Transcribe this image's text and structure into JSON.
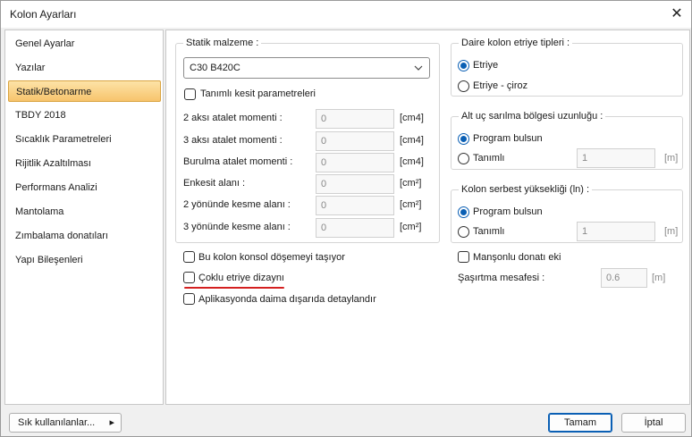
{
  "window": {
    "title": "Kolon Ayarları",
    "close_glyph": "✕"
  },
  "sidebar": {
    "items": [
      {
        "label": "Genel Ayarlar"
      },
      {
        "label": "Yazılar"
      },
      {
        "label": "Statik/Betonarme",
        "active": true
      },
      {
        "label": "TBDY 2018"
      },
      {
        "label": "Sıcaklık Parametreleri"
      },
      {
        "label": "Rijitlik Azaltılması"
      },
      {
        "label": "Performans Analizi"
      },
      {
        "label": "Mantolama"
      },
      {
        "label": "Zımbalama donatıları"
      },
      {
        "label": "Yapı Bileşenleri"
      }
    ]
  },
  "statik": {
    "group_title": "Statik malzeme :",
    "material_value": "C30 B420C",
    "custom_section_label": "Tanımlı kesit parametreleri",
    "custom_section_checked": false,
    "rows": [
      {
        "label": "2 aksı atalet momenti :",
        "value": "0",
        "unit": "[cm4]"
      },
      {
        "label": "3 aksı atalet momenti :",
        "value": "0",
        "unit": "[cm4]"
      },
      {
        "label": "Burulma atalet momenti :",
        "value": "0",
        "unit": "[cm4]"
      },
      {
        "label": "Enkesit alanı :",
        "value": "0",
        "unit": "[cm²]"
      },
      {
        "label": "2 yönünde kesme alanı :",
        "value": "0",
        "unit": "[cm²]"
      },
      {
        "label": "3 yönünde kesme alanı :",
        "value": "0",
        "unit": "[cm²]"
      }
    ]
  },
  "daire": {
    "group_title": "Daire kolon etriye tipleri :",
    "option1": "Etriye",
    "option2": "Etriye - çiroz",
    "selected": "Etriye"
  },
  "alt_uc": {
    "group_title": "Alt uç sarılma bölgesi uzunluğu :",
    "option1": "Program bulsun",
    "option2": "Tanımlı",
    "value": "1",
    "unit": "[m]"
  },
  "serbest": {
    "group_title": "Kolon serbest yüksekliği (ln) :",
    "option1": "Program bulsun",
    "option2": "Tanımlı",
    "value": "1",
    "unit": "[m]"
  },
  "options": {
    "konsol": "Bu kolon konsol döşemeyi taşıyor",
    "coklu": "Çoklu etriye dizaynı",
    "aplikasyon": "Aplikasyonda daima dışarıda detaylandır",
    "mansonlu": "Manşonlu donatı eki",
    "sasirtma_label": "Şaşırtma mesafesi :",
    "sasirtma_value": "0.6",
    "sasirtma_unit": "[m]"
  },
  "footer": {
    "favorites": "Sık kullanılanlar...",
    "favorites_arrow": "▸",
    "ok": "Tamam",
    "cancel": "İptal"
  },
  "colors": {
    "accent": "#0a5fb4",
    "selection": "#f7c46c",
    "highlight_underline": "#d42020"
  }
}
